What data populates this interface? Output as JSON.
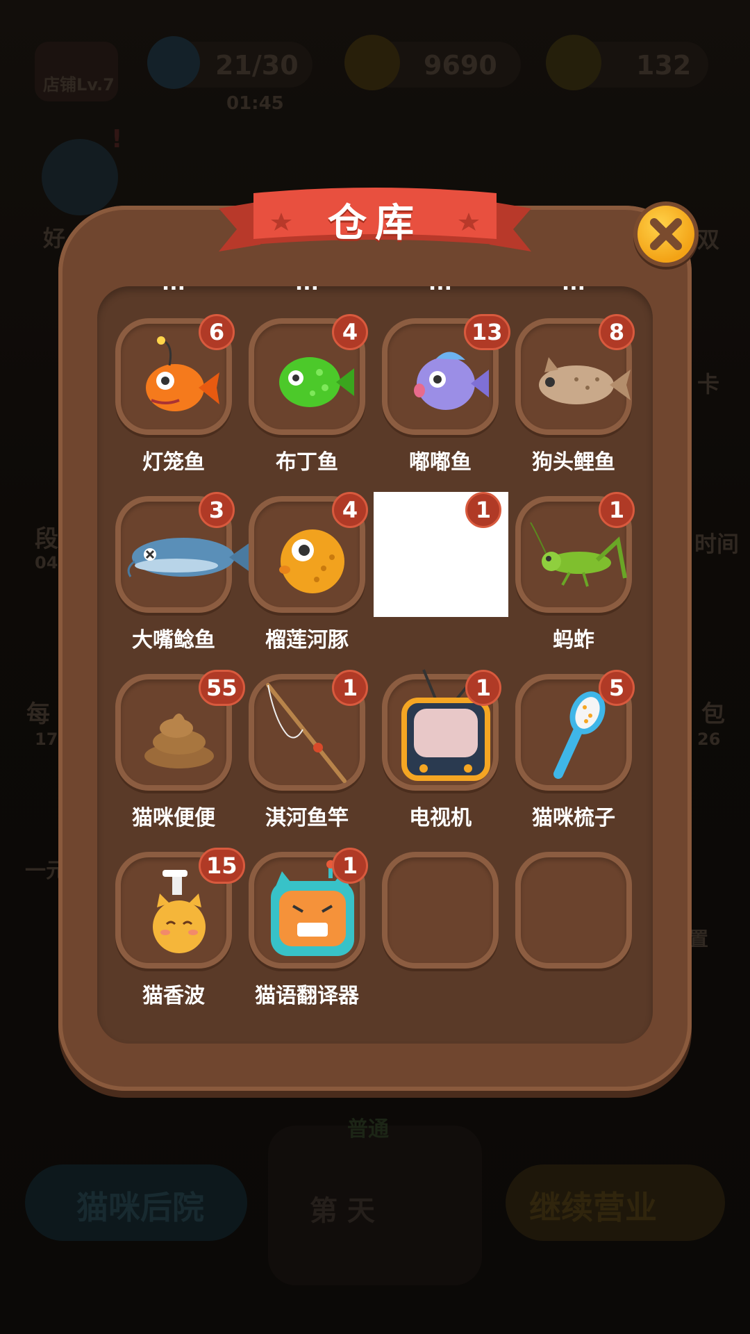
{
  "background": {
    "shop_level": "店铺Lv.7",
    "energy": "21/30",
    "energy_timer": "01:45",
    "coins": "9690",
    "stars": "132",
    "friends_short": "好",
    "left_side_1": "段",
    "left_side_1_sub": "04",
    "left_side_2": "每",
    "left_side_2_sub": "17",
    "left_side_3": "一元",
    "right_side_1": "时间",
    "right_side_2": "包",
    "right_side_2_sub": "26",
    "right_side_3": "置",
    "right_side_4": "卡",
    "right_side_5": "双",
    "btn_backyard": "猫咪后院",
    "day_label": "第 天",
    "mode_tag": "普通",
    "btn_continue": "继续营业",
    "event_badge": "!"
  },
  "dialog": {
    "title": "仓库",
    "close_icon": "close-icon",
    "partial_labels": [
      "...",
      "...",
      "...",
      "..."
    ],
    "items": [
      {
        "name": "灯笼鱼",
        "count": "6",
        "icon": "lantern-fish-icon"
      },
      {
        "name": "布丁鱼",
        "count": "4",
        "icon": "pudding-fish-icon"
      },
      {
        "name": "嘟嘟鱼",
        "count": "13",
        "icon": "dudu-fish-icon"
      },
      {
        "name": "狗头鲤鱼",
        "count": "8",
        "icon": "dog-head-carp-icon"
      },
      {
        "name": "大嘴鲶鱼",
        "count": "3",
        "icon": "catfish-icon"
      },
      {
        "name": "榴莲河豚",
        "count": "4",
        "icon": "durian-pufferfish-icon"
      },
      {
        "name": "",
        "count": "1",
        "icon": "blank-image"
      },
      {
        "name": "蚂蚱",
        "count": "1",
        "icon": "grasshopper-icon"
      },
      {
        "name": "猫咪便便",
        "count": "55",
        "icon": "cat-poop-icon"
      },
      {
        "name": "淇河鱼竿",
        "count": "1",
        "icon": "fishing-rod-icon"
      },
      {
        "name": "电视机",
        "count": "1",
        "icon": "tv-icon"
      },
      {
        "name": "猫咪梳子",
        "count": "5",
        "icon": "cat-comb-icon"
      },
      {
        "name": "猫香波",
        "count": "15",
        "icon": "cat-shampoo-icon"
      },
      {
        "name": "猫语翻译器",
        "count": "1",
        "icon": "cat-translator-icon"
      },
      {
        "name": "",
        "count": "",
        "icon": "empty-slot"
      },
      {
        "name": "",
        "count": "",
        "icon": "empty-slot"
      }
    ]
  },
  "colors": {
    "dialog_frame": "#70462f",
    "dialog_inner": "#5a3a28",
    "slot_border": "#8c5d41",
    "badge": "#b03a26",
    "ribbon": "#e8503f",
    "close_button": "#f3a316"
  }
}
